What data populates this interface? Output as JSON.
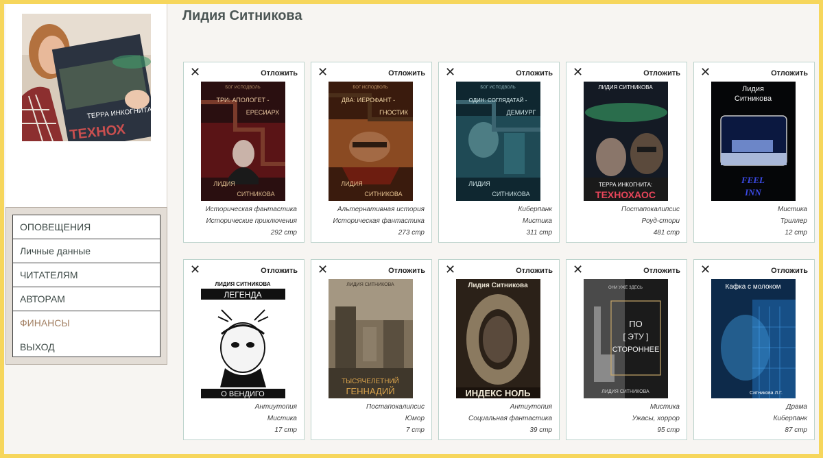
{
  "author_name": "Лидия Ситникова",
  "menu": {
    "notifications": "ОПОВЕЩЕНИЯ",
    "personal": "Личные данные",
    "readers": "ЧИТАТЕЛЯМ",
    "authors": "АВТОРАМ",
    "finances": "ФИНАНСЫ",
    "logout": "ВЫХОД"
  },
  "defer_label": "Отложить",
  "books": [
    {
      "genre1": "Историческая фантастика",
      "genre2": "Исторические приключения",
      "pages": "292 стр",
      "cover_top": "БОГ ИСПОДВОЛЬ",
      "cover_title": "ТРИ: АПОЛОГЕТ - ЕРЕСИАРХ",
      "cover_author": "ЛИДИЯ СИТНИКОВА"
    },
    {
      "genre1": "Альтернативная история",
      "genre2": "Историческая фантастика",
      "pages": "273 стр",
      "cover_top": "БОГ ИСПОДВОЛЬ",
      "cover_title": "ДВА: ИЕРОФАНТ - ГНОСТИК",
      "cover_author": "ЛИДИЯ СИТНИКОВА"
    },
    {
      "genre1": "Киберпанк",
      "genre2": "Мистика",
      "pages": "311 стр",
      "cover_top": "БОГ ИСПОДВОЛЬ",
      "cover_title": "ОДИН: СОГЛЯДАТАЙ - ДЕМИУРГ",
      "cover_author": "ЛИДИЯ СИТНИКОВА"
    },
    {
      "genre1": "Постапокалипсис",
      "genre2": "Роуд-стори",
      "pages": "481 стр",
      "cover_top": "ЛИДИЯ СИТНИКОВА",
      "cover_title": "ТЕРРА ИНКОГНИТА:",
      "cover_author": "ТЕХНОХАОС"
    },
    {
      "genre1": "Мистика",
      "genre2": "Триллер",
      "pages": "12 стр",
      "cover_top": "Лидия Ситникова",
      "cover_title": "FEEL INN",
      "cover_author": ""
    },
    {
      "genre1": "Антиутопия",
      "genre2": "Мистика",
      "pages": "17 стр",
      "cover_top": "ЛИДИЯ СИТНИКОВА",
      "cover_title": "ЛЕГЕНДА",
      "cover_author": "О ВЕНДИГО"
    },
    {
      "genre1": "Постапокалипсис",
      "genre2": "Юмор",
      "pages": "7 стр",
      "cover_top": "ЛИДИЯ СИТНИКОВА",
      "cover_title": "ТЫСЯЧЕЛЕТНИЙ",
      "cover_author": "ГЕННАДИЙ"
    },
    {
      "genre1": "Антиутопия",
      "genre2": "Социальная фантастика",
      "pages": "39 стр",
      "cover_top": "Лидия Ситникова",
      "cover_title": "О",
      "cover_author": "ИНДЕКС НОЛЬ"
    },
    {
      "genre1": "Мистика",
      "genre2": "Ужасы, хоррор",
      "pages": "95 стр",
      "cover_top": "ОНИ УЖЕ ЗДЕСЬ",
      "cover_title": "ПО [ ЭТУ ] СТОРОННЕЕ",
      "cover_author": "ЛИДИЯ СИТНИКОВА"
    },
    {
      "genre1": "Драма",
      "genre2": "Киберпанк",
      "pages": "87 стр",
      "cover_top": "Кафка с молоком",
      "cover_title": "",
      "cover_author": "Ситникова Л.Г."
    }
  ]
}
